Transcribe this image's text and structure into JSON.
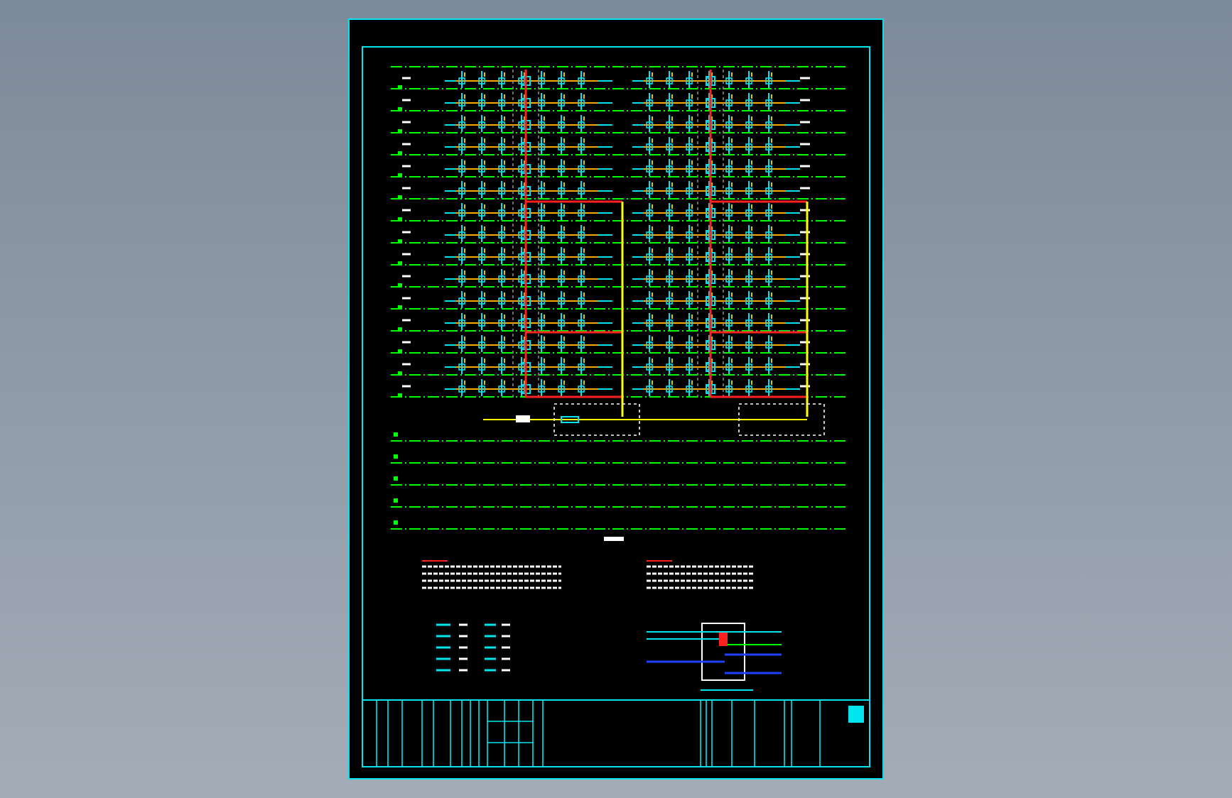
{
  "sheet": {
    "kind": "riser"
  },
  "upper_floors": [
    {
      "kind": "fixtures"
    },
    {
      "kind": "fixtures"
    },
    {
      "kind": "fixtures"
    },
    {
      "kind": "fixtures"
    },
    {
      "kind": "fixtures"
    },
    {
      "kind": "fixtures"
    },
    {
      "kind": "fixtures"
    },
    {
      "kind": "fixtures"
    },
    {
      "kind": "fixtures"
    },
    {
      "kind": "fixtures"
    },
    {
      "kind": "fixtures"
    },
    {
      "kind": "fixtures"
    },
    {
      "kind": "fixtures"
    },
    {
      "kind": "fixtures"
    },
    {
      "kind": "fixtures"
    }
  ],
  "lower_floors": [
    {
      "kind": "plain"
    },
    {
      "kind": "plain"
    },
    {
      "kind": "plain"
    },
    {
      "kind": "plain"
    },
    {
      "kind": "plain"
    }
  ]
}
